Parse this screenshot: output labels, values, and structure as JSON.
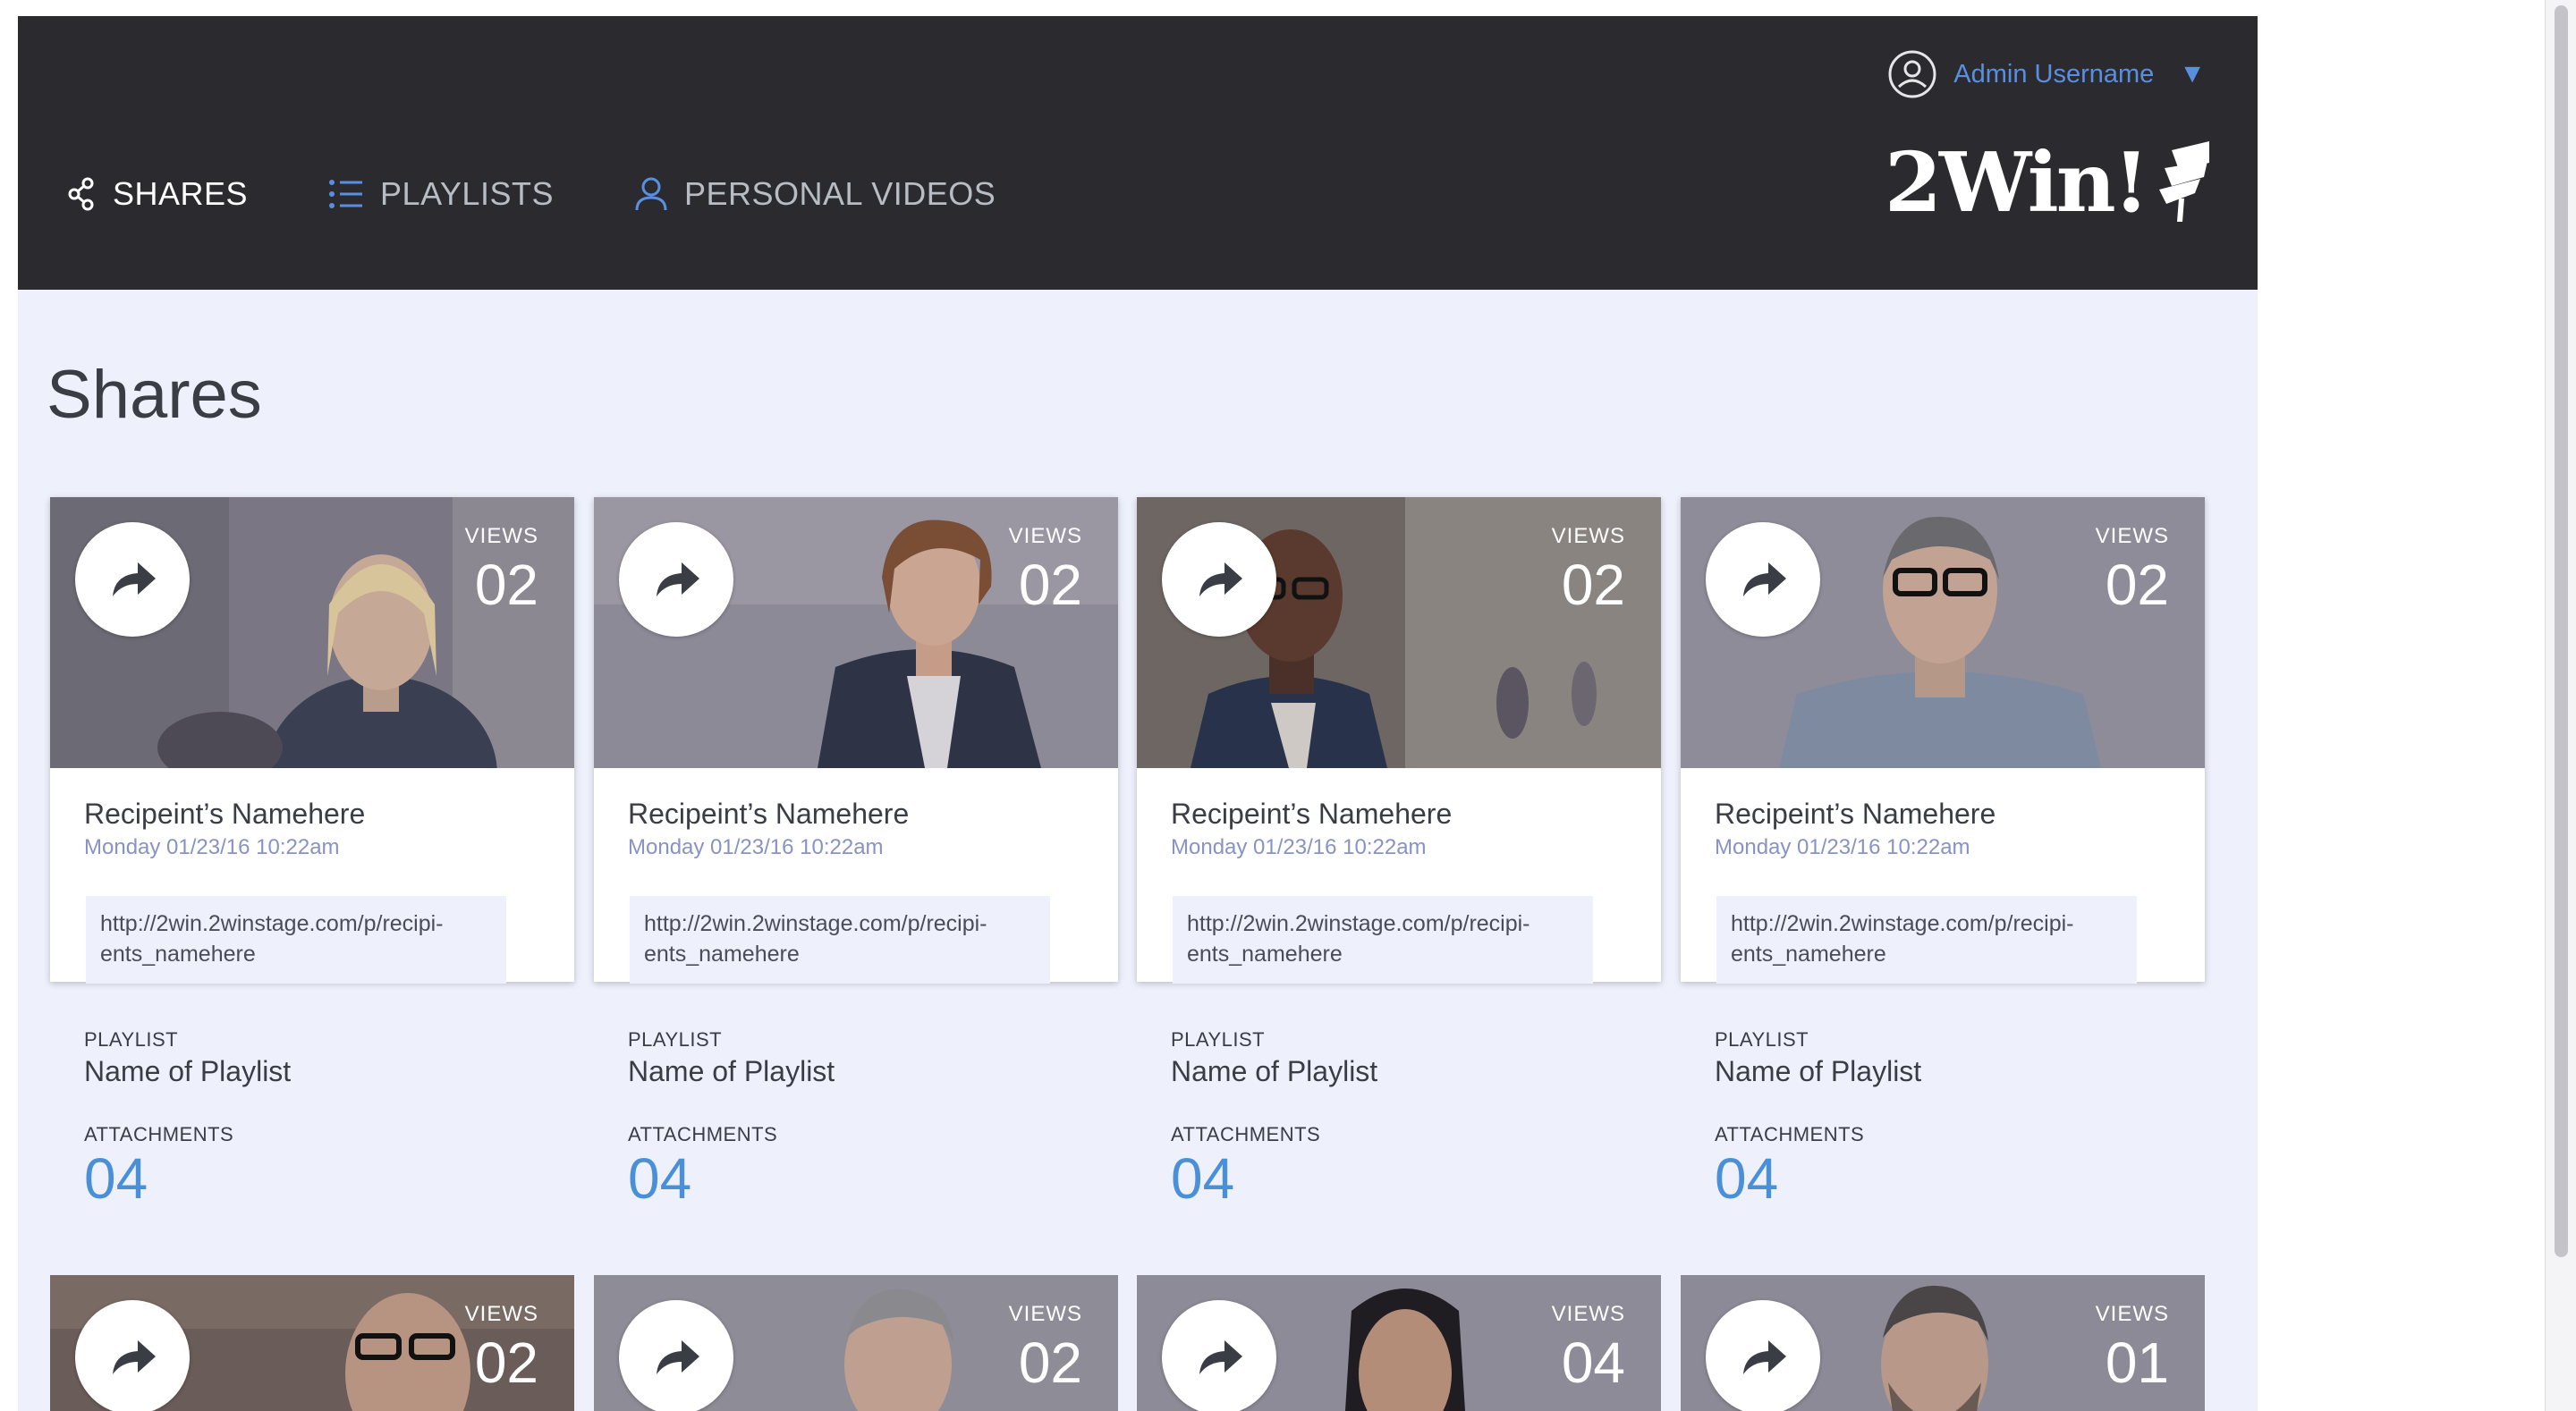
{
  "header": {
    "user_name": "Admin Username",
    "user_icon": "user-circle-icon",
    "caret_icon": "triangle-down-icon",
    "logo_text": "2Win!",
    "logo_mark_icon": "flag-swoosh-icon"
  },
  "nav": {
    "shares": {
      "label": "SHARES",
      "icon": "share-icon",
      "active": true
    },
    "playlists": {
      "label": "PLAYLISTS",
      "icon": "list-icon",
      "active": false
    },
    "personal_videos": {
      "label": "PERSONAL VIDEOS",
      "icon": "person-icon",
      "active": false
    }
  },
  "page": {
    "title": "Shares"
  },
  "cards": [
    {
      "views_label": "VIEWS",
      "views": "02",
      "recipient": "Recipeint’s Namehere",
      "date": "Monday 01/23/16 10:22am",
      "url": "http://2win.2winstage.com/p/recipi-ents_namehere",
      "playlist_label": "PLAYLIST",
      "playlist": "Name of Playlist",
      "attachments_label": "ATTACHMENTS",
      "attachments": "04",
      "photo": "woman-blonde-portrait"
    },
    {
      "views_label": "VIEWS",
      "views": "02",
      "recipient": "Recipeint’s Namehere",
      "date": "Monday 01/23/16 10:22am",
      "url": "http://2win.2winstage.com/p/recipi-ents_namehere",
      "playlist_label": "PLAYLIST",
      "playlist": "Name of Playlist",
      "attachments_label": "ATTACHMENTS",
      "attachments": "04",
      "photo": "woman-curly-hair-portrait"
    },
    {
      "views_label": "VIEWS",
      "views": "02",
      "recipient": "Recipeint’s Namehere",
      "date": "Monday 01/23/16 10:22am",
      "url": "http://2win.2winstage.com/p/recipi-ents_namehere",
      "playlist_label": "PLAYLIST",
      "playlist": "Name of Playlist",
      "attachments_label": "ATTACHMENTS",
      "attachments": "04",
      "photo": "man-glasses-office-portrait"
    },
    {
      "views_label": "VIEWS",
      "views": "02",
      "recipient": "Recipeint’s Namehere",
      "date": "Monday 01/23/16 10:22am",
      "url": "http://2win.2winstage.com/p/recipi-ents_namehere",
      "playlist_label": "PLAYLIST",
      "playlist": "Name of Playlist",
      "attachments_label": "ATTACHMENTS",
      "attachments": "04",
      "photo": "man-grey-hair-glasses-portrait"
    },
    {
      "views_label": "VIEWS",
      "views": "02",
      "photo": "man-glasses-brick-wall-portrait"
    },
    {
      "views_label": "VIEWS",
      "views": "02",
      "photo": "man-office-portrait"
    },
    {
      "views_label": "VIEWS",
      "views": "04",
      "photo": "woman-dark-hair-portrait"
    },
    {
      "views_label": "VIEWS",
      "views": "01",
      "photo": "man-beard-portrait"
    }
  ],
  "colors": {
    "header_bg": "#2b2b2f",
    "page_bg": "#eef0fc",
    "accent_blue": "#4a90d9",
    "user_link": "#5a8fe0",
    "date_text": "#8892c4"
  }
}
